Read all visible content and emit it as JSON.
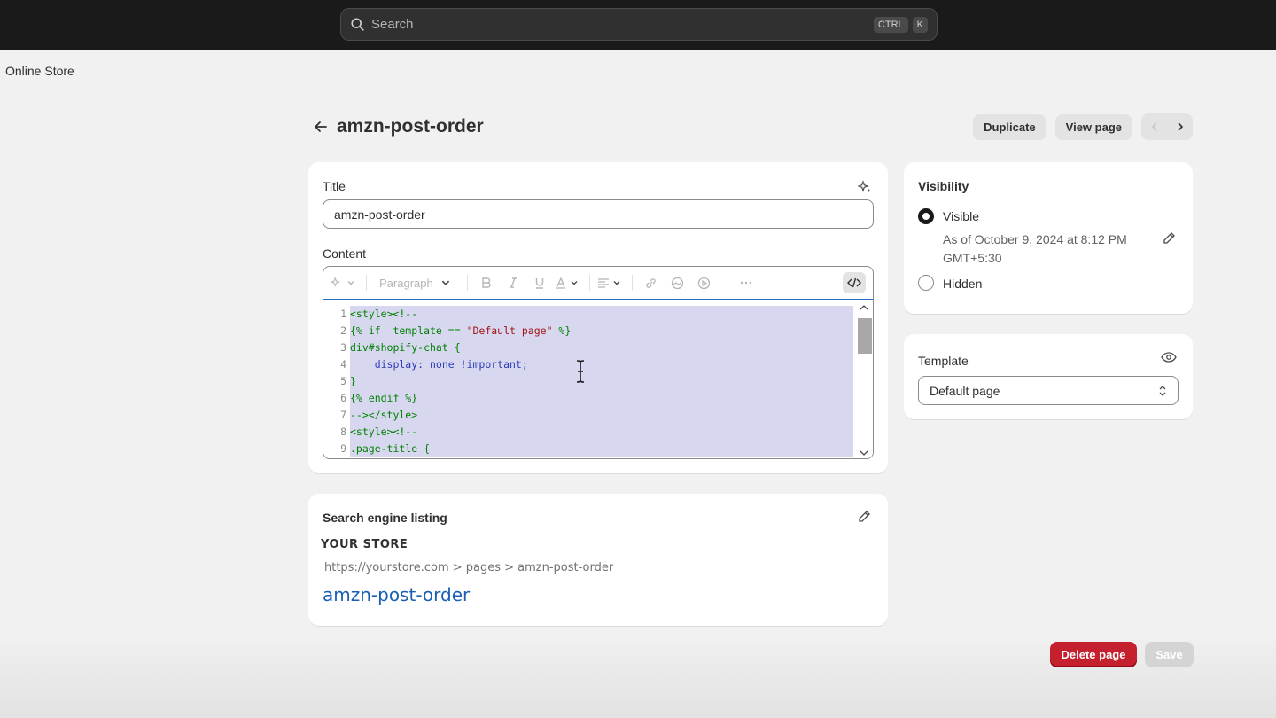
{
  "search": {
    "placeholder": "Search",
    "shortcut_ctrl": "CTRL",
    "shortcut_key": "K"
  },
  "breadcrumb": "Online Store",
  "page": {
    "title": "amzn-post-order"
  },
  "actions": {
    "duplicate": "Duplicate",
    "view_page": "View page"
  },
  "form": {
    "title_label": "Title",
    "title_value": "amzn-post-order",
    "content_label": "Content",
    "toolbar": {
      "paragraph": "Paragraph"
    },
    "code_lines": [
      {
        "n": "1",
        "parts": [
          [
            "k",
            "<style><!--"
          ]
        ]
      },
      {
        "n": "2",
        "parts": [
          [
            "k",
            "{% if  template == "
          ],
          [
            "s",
            "\"Default page\""
          ],
          [
            "k",
            " %}"
          ]
        ]
      },
      {
        "n": "3",
        "parts": [
          [
            "k",
            "div#shopify-chat {"
          ]
        ]
      },
      {
        "n": "4",
        "parts": [
          [
            "p",
            "    display: none !important;"
          ]
        ]
      },
      {
        "n": "5",
        "parts": [
          [
            "k",
            "}"
          ]
        ]
      },
      {
        "n": "6",
        "parts": [
          [
            "k",
            "{% endif %}"
          ]
        ]
      },
      {
        "n": "7",
        "parts": [
          [
            "k",
            "--></style>"
          ]
        ]
      },
      {
        "n": "8",
        "parts": [
          [
            "k",
            "<style><!--"
          ]
        ]
      },
      {
        "n": "9",
        "parts": [
          [
            "k",
            ".page-title {"
          ]
        ]
      }
    ]
  },
  "seo": {
    "heading": "Search engine listing",
    "store_name": "YOUR STORE",
    "url": "https://yourstore.com > pages > amzn-post-order",
    "link_title": "amzn-post-order"
  },
  "visibility": {
    "heading": "Visibility",
    "visible_label": "Visible",
    "visible_date": "As of October 9, 2024 at 8:12 PM",
    "visible_tz": "GMT+5:30",
    "hidden_label": "Hidden",
    "selected": "Visible"
  },
  "template": {
    "heading": "Template",
    "selected": "Default page"
  },
  "footer": {
    "delete": "Delete page",
    "save": "Save"
  },
  "colors": {
    "accent": "#2a6ecc",
    "danger": "#c5202d",
    "selection": "#d7d8f0"
  }
}
